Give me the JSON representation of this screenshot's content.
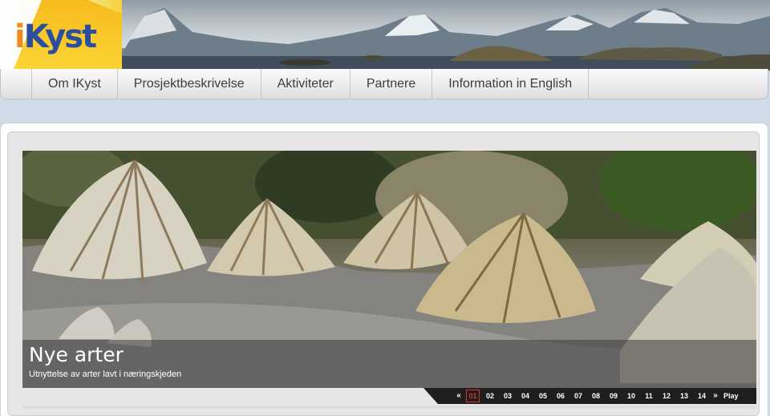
{
  "logo": {
    "brand_prefix": "i",
    "brand_rest": "Kyst"
  },
  "nav": {
    "items": [
      {
        "label": "Om IKyst"
      },
      {
        "label": "Prosjektbeskrivelse"
      },
      {
        "label": "Aktiviteter"
      },
      {
        "label": "Partnere"
      },
      {
        "label": "Information in English"
      }
    ]
  },
  "slideshow": {
    "title": "Nye arter",
    "subtitle": "Utnyttelse av arter lavt i næringskjeden",
    "prev_label": "«",
    "next_label": "»",
    "play_label": "Play",
    "active_page": "01",
    "pages": [
      "01",
      "02",
      "03",
      "04",
      "05",
      "06",
      "07",
      "08",
      "09",
      "10",
      "11",
      "12",
      "13",
      "14"
    ]
  },
  "colors": {
    "nav_text": "#3c3c3c",
    "pager_active": "#e0302a",
    "logo_blue": "#2c4e9e",
    "logo_orange": "#f08a1c"
  }
}
